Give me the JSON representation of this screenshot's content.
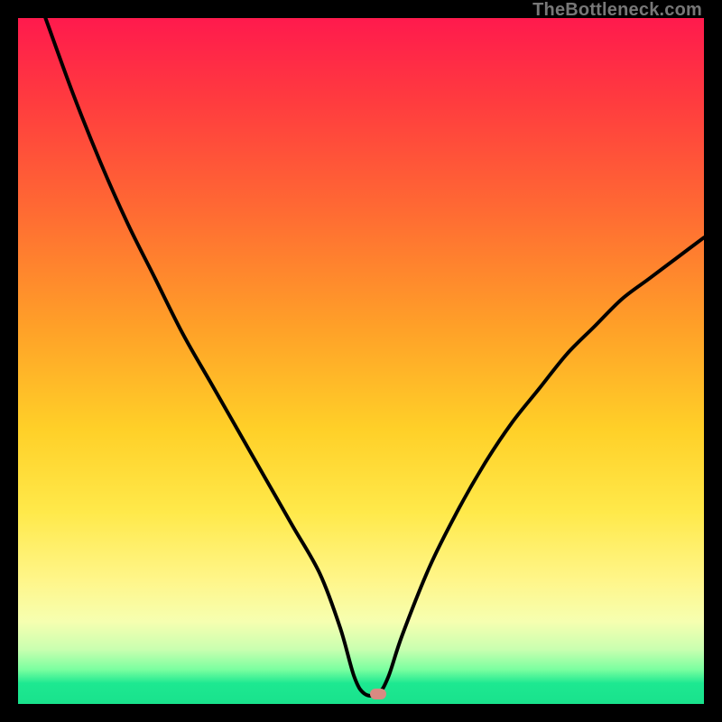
{
  "watermark": "TheBottleneck.com",
  "marker": {
    "x_frac": 0.525,
    "y_frac": 0.985
  },
  "chart_data": {
    "type": "line",
    "title": "",
    "xlabel": "",
    "ylabel": "",
    "xlim": [
      0,
      100
    ],
    "ylim": [
      0,
      100
    ],
    "series": [
      {
        "name": "bottleneck-curve",
        "x": [
          4,
          8,
          12,
          16,
          20,
          24,
          28,
          32,
          36,
          40,
          44,
          47,
          49,
          50.5,
          52.5,
          54,
          56,
          60,
          64,
          68,
          72,
          76,
          80,
          84,
          88,
          92,
          96,
          100
        ],
        "values": [
          100,
          89,
          79,
          70,
          62,
          54,
          47,
          40,
          33,
          26,
          19,
          11,
          4,
          1.5,
          1.5,
          4,
          10,
          20,
          28,
          35,
          41,
          46,
          51,
          55,
          59,
          62,
          65,
          68
        ]
      }
    ],
    "annotations": [
      {
        "type": "marker",
        "x": 52.5,
        "y": 1.5,
        "color": "#d98a82"
      }
    ],
    "background_gradient": {
      "stops": [
        {
          "pos": 0,
          "color": "#ff1a4d"
        },
        {
          "pos": 12,
          "color": "#ff3b3f"
        },
        {
          "pos": 28,
          "color": "#ff6a33"
        },
        {
          "pos": 45,
          "color": "#ffa028"
        },
        {
          "pos": 60,
          "color": "#ffd028"
        },
        {
          "pos": 72,
          "color": "#ffe94a"
        },
        {
          "pos": 82,
          "color": "#fff68a"
        },
        {
          "pos": 88,
          "color": "#f6ffb0"
        },
        {
          "pos": 92,
          "color": "#caffb0"
        },
        {
          "pos": 95,
          "color": "#7affa0"
        },
        {
          "pos": 97,
          "color": "#1de891"
        },
        {
          "pos": 100,
          "color": "#19e28c"
        }
      ]
    }
  }
}
